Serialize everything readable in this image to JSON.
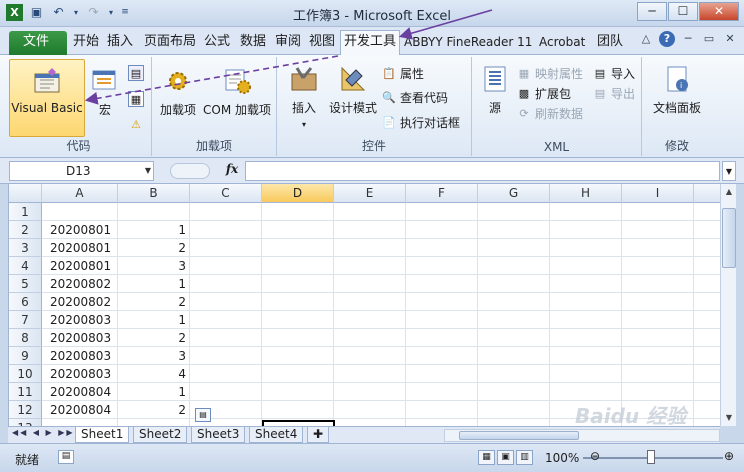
{
  "window": {
    "title": "工作簿3 - Microsoft Excel",
    "controls": [
      "─",
      "☐",
      "✕"
    ]
  },
  "qat": {
    "save": "💾",
    "undo": "↶",
    "redo": "↷"
  },
  "tabs": [
    "文件",
    "开始",
    "插入",
    "页面布局",
    "公式",
    "数据",
    "审阅",
    "视图",
    "开发工具",
    "ABBYY FineReader 11",
    "Acrobat",
    "团队"
  ],
  "ribbon": {
    "code": {
      "label": "代码",
      "visual_basic": "Visual Basic",
      "macro": "宏"
    },
    "addins": {
      "label": "加载项",
      "addins": "加载项",
      "com": "COM 加载项"
    },
    "controls": {
      "label": "控件",
      "insert": "插入",
      "design_mode": "设计模式",
      "properties": "属性",
      "view_code": "查看代码",
      "run_dialog": "执行对话框"
    },
    "xml": {
      "label": "XML",
      "source": "源",
      "map_props": "映射属性",
      "expansion": "扩展包",
      "refresh": "刷新数据",
      "import": "导入",
      "export": "导出"
    },
    "modify": {
      "label": "修改",
      "doc_panel": "文档面板"
    }
  },
  "formula_bar": {
    "name_box": "D13",
    "fx": "fx",
    "value": ""
  },
  "grid": {
    "columns": [
      "A",
      "B",
      "C",
      "D",
      "E",
      "F",
      "G",
      "H",
      "I"
    ],
    "selected_column": "D",
    "rows": [
      {
        "n": "1",
        "a": "",
        "b": ""
      },
      {
        "n": "2",
        "a": "20200801",
        "b": "1"
      },
      {
        "n": "3",
        "a": "20200801",
        "b": "2"
      },
      {
        "n": "4",
        "a": "20200801",
        "b": "3"
      },
      {
        "n": "5",
        "a": "20200802",
        "b": "1"
      },
      {
        "n": "6",
        "a": "20200802",
        "b": "2"
      },
      {
        "n": "7",
        "a": "20200803",
        "b": "1"
      },
      {
        "n": "8",
        "a": "20200803",
        "b": "2"
      },
      {
        "n": "9",
        "a": "20200803",
        "b": "3"
      },
      {
        "n": "10",
        "a": "20200803",
        "b": "4"
      },
      {
        "n": "11",
        "a": "20200804",
        "b": "1"
      },
      {
        "n": "12",
        "a": "20200804",
        "b": "2"
      }
    ]
  },
  "sheets": [
    "Sheet1",
    "Sheet2",
    "Sheet3",
    "Sheet4"
  ],
  "status": {
    "ready": "就绪",
    "zoom": "100%"
  },
  "watermark": "Baidu 经验"
}
